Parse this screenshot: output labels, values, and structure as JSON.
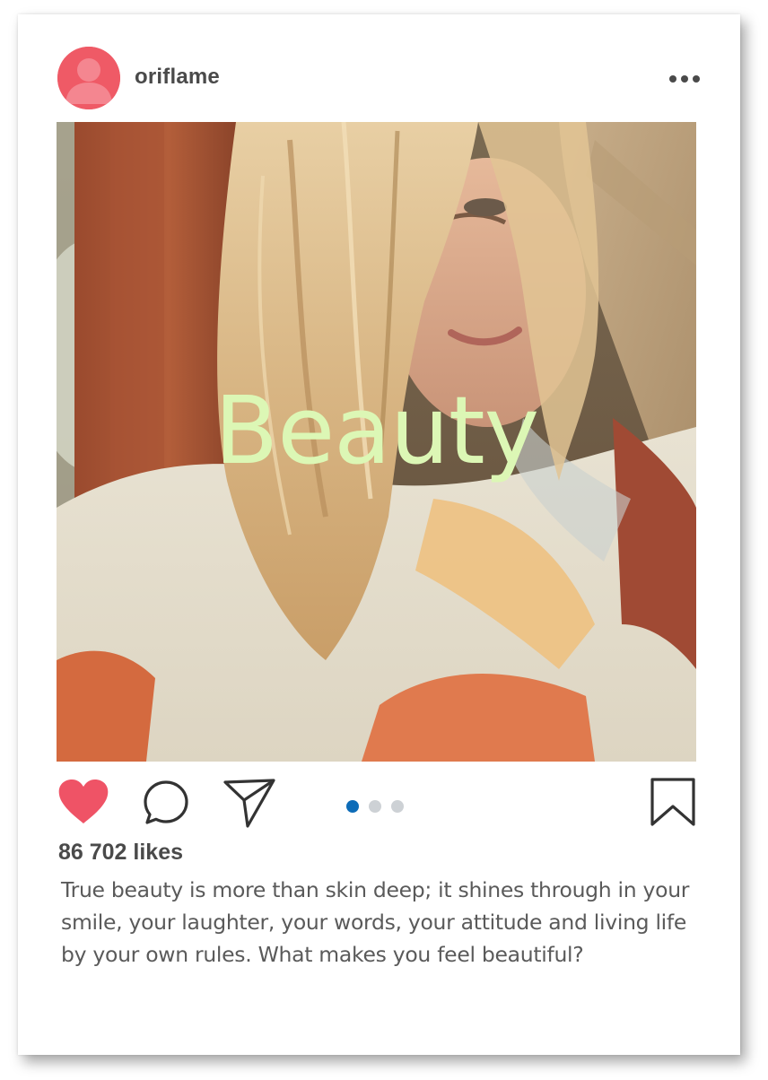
{
  "post": {
    "username": "oriflame",
    "image_overlay_text": "Beauty",
    "likes": "86 702 likes",
    "caption": "True beauty is more than skin deep; it shines through in your smile, your laughter, your words, your attitude and living life by your own rules. What makes you feel beautiful?",
    "carousel": {
      "total": 3,
      "active_index": 0
    }
  },
  "icons": {
    "avatar": "user-avatar-icon",
    "more": "more-options-icon",
    "like": "heart-icon",
    "comment": "comment-icon",
    "share": "paper-plane-icon",
    "save": "bookmark-icon"
  },
  "colors": {
    "avatar_bg": "#ef5a66",
    "heart": "#ef5366",
    "overlay_text": "#dcf7b5",
    "carousel_active": "#0d6cb8",
    "carousel_inactive": "#cdd1d5",
    "text": "#4a4a4a"
  }
}
